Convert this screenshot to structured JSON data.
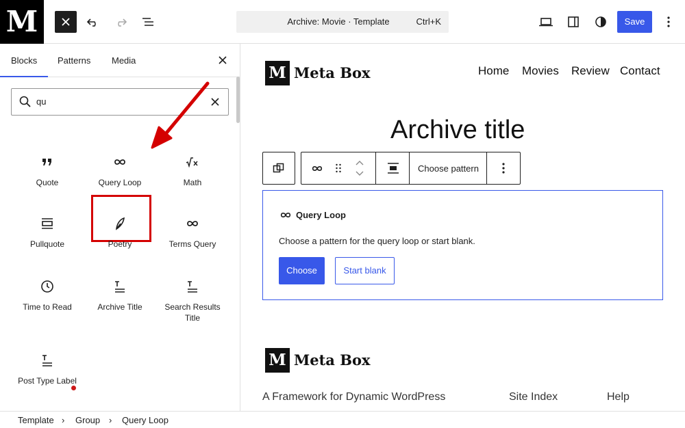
{
  "topbar": {
    "logo_letter": "M",
    "command_title": "Archive: Movie · Template",
    "command_shortcut": "Ctrl+K",
    "save_label": "Save",
    "icons": [
      "close-icon",
      "undo-icon",
      "redo-icon",
      "list-view-icon",
      "desktop-view-icon",
      "sidebar-toggle-icon",
      "styles-icon",
      "more-options-icon"
    ]
  },
  "inserter": {
    "tabs": [
      {
        "label": "Blocks",
        "active": true
      },
      {
        "label": "Patterns",
        "active": false
      },
      {
        "label": "Media",
        "active": false
      }
    ],
    "search": {
      "value": "qu",
      "placeholder": "Search"
    },
    "blocks": [
      {
        "label": "Quote",
        "icon": "quote-icon"
      },
      {
        "label": "Query Loop",
        "icon": "loop-icon",
        "highlighted": true
      },
      {
        "label": "Math",
        "icon": "math-icon"
      },
      {
        "label": "Pullquote",
        "icon": "pullquote-icon"
      },
      {
        "label": "Poetry",
        "icon": "feather-icon"
      },
      {
        "label": "Terms Query",
        "icon": "loop-icon"
      },
      {
        "label": "Time to Read",
        "icon": "clock-icon"
      },
      {
        "label": "Archive Title",
        "icon": "title-icon"
      },
      {
        "label": "Search Results Title",
        "icon": "title-icon"
      },
      {
        "label": "Post Type Label",
        "icon": "title-icon"
      }
    ]
  },
  "canvas": {
    "site_logo_letter": "M",
    "site_name": "Meta Box",
    "nav": [
      "Home",
      "Movies",
      "Review",
      "Contact"
    ],
    "archive_title": "Archive title",
    "block_toolbar": {
      "choose_pattern": "Choose pattern"
    },
    "query_loop": {
      "label": "Query Loop",
      "instructions": "Choose a pattern for the query loop or start blank.",
      "choose_label": "Choose",
      "start_blank_label": "Start blank"
    },
    "footer": {
      "site_name": "Meta Box",
      "logo_letter": "M",
      "tagline": "A Framework for Dynamic WordPress",
      "links": [
        "Site Index",
        "Help"
      ]
    }
  },
  "breadcrumb": [
    "Template",
    "Group",
    "Query Loop"
  ],
  "colors": {
    "accent": "#3858e9",
    "annotation": "#d40000",
    "text": "#1e1e1e"
  }
}
